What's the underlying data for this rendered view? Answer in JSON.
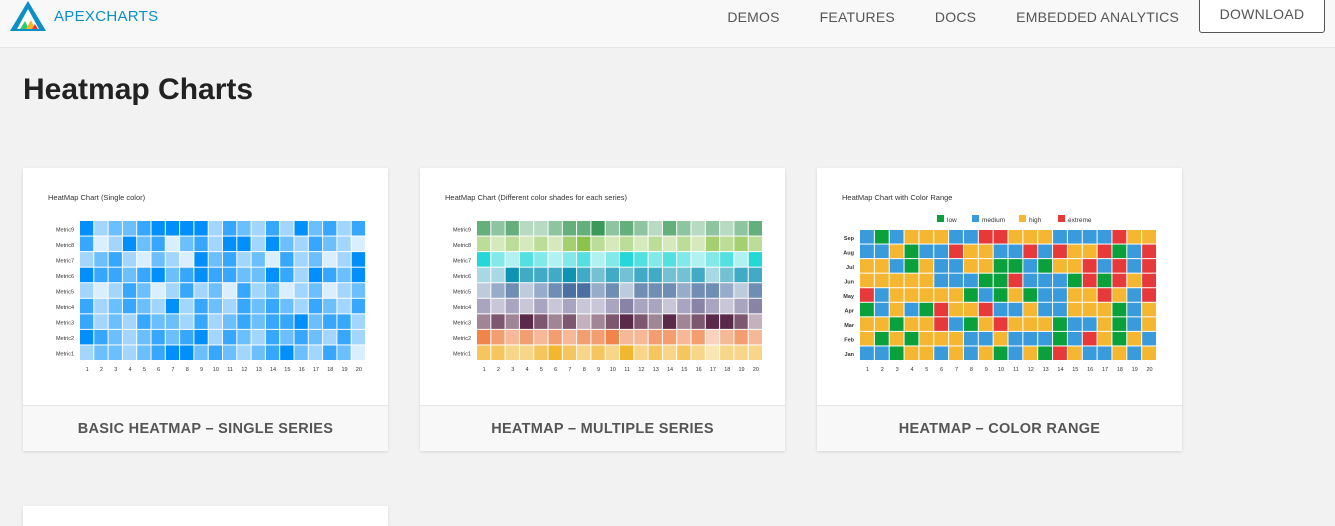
{
  "brand": {
    "name": "APEXCHARTS"
  },
  "nav": {
    "links": [
      "DEMOS",
      "FEATURES",
      "DOCS",
      "EMBEDDED ANALYTICS"
    ],
    "download_label": "DOWNLOAD"
  },
  "page": {
    "title": "Heatmap Charts"
  },
  "cards": [
    {
      "label": "BASIC HEATMAP – SINGLE SERIES"
    },
    {
      "label": "HEATMAP – MULTIPLE SERIES"
    },
    {
      "label": "HEATMAP – COLOR RANGE"
    }
  ],
  "chart_data": [
    {
      "type": "heatmap",
      "title": "HeatMap Chart (Single color)",
      "series_names": [
        "Metric9",
        "Metric8",
        "Metric7",
        "Metric6",
        "Metric5",
        "Metric4",
        "Metric3",
        "Metric2",
        "Metric1"
      ],
      "x": [
        "1",
        "2",
        "3",
        "4",
        "5",
        "6",
        "7",
        "8",
        "9",
        "10",
        "11",
        "12",
        "13",
        "14",
        "15",
        "16",
        "17",
        "18",
        "19",
        "20"
      ],
      "color": "#008FFB",
      "values": [
        [
          4,
          1,
          2,
          2,
          3,
          4,
          4,
          4,
          4,
          1,
          3,
          2,
          1,
          3,
          1,
          4,
          2,
          3,
          1,
          3
        ],
        [
          3,
          0,
          1,
          4,
          2,
          3,
          0,
          2,
          3,
          1,
          4,
          4,
          1,
          4,
          2,
          1,
          3,
          2,
          1,
          0
        ],
        [
          1,
          2,
          3,
          1,
          0,
          2,
          1,
          0,
          4,
          2,
          3,
          1,
          2,
          0,
          3,
          1,
          2,
          0,
          1,
          4
        ],
        [
          4,
          3,
          3,
          2,
          3,
          4,
          2,
          3,
          4,
          3,
          3,
          2,
          2,
          4,
          3,
          1,
          4,
          3,
          2,
          4
        ],
        [
          1,
          0,
          1,
          3,
          2,
          0,
          1,
          3,
          1,
          2,
          0,
          3,
          1,
          2,
          0,
          1,
          2,
          0,
          1,
          2
        ],
        [
          3,
          1,
          2,
          3,
          2,
          1,
          4,
          1,
          3,
          2,
          1,
          3,
          2,
          3,
          2,
          1,
          3,
          2,
          1,
          3
        ],
        [
          3,
          1,
          2,
          1,
          3,
          2,
          2,
          1,
          3,
          1,
          2,
          3,
          2,
          3,
          3,
          4,
          2,
          3,
          3,
          1
        ],
        [
          4,
          3,
          2,
          1,
          2,
          3,
          2,
          3,
          4,
          1,
          3,
          2,
          1,
          3,
          2,
          3,
          2,
          1,
          3,
          1
        ],
        [
          1,
          2,
          2,
          1,
          2,
          3,
          4,
          4,
          2,
          3,
          2,
          1,
          2,
          3,
          4,
          2,
          1,
          3,
          2,
          0
        ]
      ]
    },
    {
      "type": "heatmap",
      "title": "HeatMap Chart (Different color shades for each series)",
      "series_names": [
        "Metric9",
        "Metric8",
        "Metric7",
        "Metric6",
        "Metric5",
        "Metric4",
        "Metric3",
        "Metric2",
        "Metric1"
      ],
      "x": [
        "1",
        "2",
        "3",
        "4",
        "5",
        "6",
        "7",
        "8",
        "9",
        "10",
        "11",
        "12",
        "13",
        "14",
        "15",
        "16",
        "17",
        "18",
        "19",
        "20"
      ],
      "colors": [
        "#3B9A5A",
        "#8BC34A",
        "#26D7D7",
        "#0E93B5",
        "#4A6FA0",
        "#6A6190",
        "#5A2A4A",
        "#F0844A",
        "#F2B731"
      ],
      "values": [
        [
          3,
          2,
          3,
          1,
          1,
          2,
          3,
          3,
          4,
          2,
          3,
          2,
          1,
          3,
          2,
          1,
          2,
          1,
          2,
          3
        ],
        [
          2,
          1,
          2,
          1,
          2,
          1,
          3,
          4,
          2,
          1,
          2,
          1,
          2,
          1,
          2,
          1,
          3,
          2,
          3,
          2
        ],
        [
          4,
          2,
          1,
          3,
          2,
          1,
          2,
          3,
          1,
          2,
          4,
          3,
          2,
          3,
          2,
          1,
          2,
          3,
          1,
          4
        ],
        [
          1,
          1,
          4,
          3,
          3,
          3,
          4,
          3,
          2,
          3,
          2,
          3,
          3,
          2,
          2,
          3,
          1,
          2,
          3,
          3
        ],
        [
          1,
          2,
          3,
          1,
          2,
          3,
          4,
          4,
          2,
          3,
          1,
          3,
          3,
          3,
          2,
          3,
          3,
          2,
          1,
          3
        ],
        [
          2,
          1,
          2,
          1,
          2,
          1,
          2,
          1,
          1,
          2,
          3,
          2,
          2,
          1,
          2,
          3,
          2,
          1,
          2,
          3
        ],
        [
          2,
          3,
          2,
          4,
          3,
          2,
          3,
          1,
          2,
          3,
          4,
          3,
          2,
          4,
          2,
          3,
          4,
          4,
          3,
          1
        ],
        [
          4,
          3,
          2,
          3,
          2,
          3,
          2,
          3,
          3,
          4,
          2,
          2,
          3,
          3,
          2,
          3,
          1,
          2,
          3,
          2
        ],
        [
          3,
          3,
          2,
          2,
          3,
          4,
          3,
          2,
          3,
          2,
          4,
          2,
          3,
          2,
          3,
          2,
          1,
          2,
          2,
          2
        ]
      ]
    },
    {
      "type": "heatmap",
      "title": "HeatMap Chart with Color Range",
      "legend": [
        {
          "name": "low",
          "color": "#0AA03C"
        },
        {
          "name": "medium",
          "color": "#3A9BDC"
        },
        {
          "name": "high",
          "color": "#F5B731"
        },
        {
          "name": "extreme",
          "color": "#E8393A"
        }
      ],
      "legend_position": "top",
      "series_names": [
        "Sep",
        "Aug",
        "Jul",
        "Jun",
        "May",
        "Apr",
        "Mar",
        "Feb",
        "Jan"
      ],
      "x": [
        "1",
        "2",
        "3",
        "4",
        "5",
        "6",
        "7",
        "8",
        "9",
        "10",
        "11",
        "12",
        "13",
        "14",
        "15",
        "16",
        "17",
        "18",
        "19",
        "20"
      ],
      "values": [
        [
          1,
          0,
          1,
          2,
          2,
          2,
          1,
          1,
          3,
          3,
          2,
          2,
          2,
          1,
          1,
          1,
          1,
          3,
          2,
          2
        ],
        [
          1,
          1,
          2,
          0,
          1,
          1,
          3,
          2,
          2,
          1,
          1,
          3,
          1,
          3,
          2,
          2,
          3,
          0,
          1,
          3
        ],
        [
          2,
          2,
          1,
          0,
          2,
          1,
          1,
          2,
          2,
          0,
          0,
          1,
          0,
          2,
          2,
          3,
          1,
          3,
          1,
          3
        ],
        [
          2,
          2,
          2,
          2,
          2,
          1,
          1,
          1,
          0,
          0,
          3,
          1,
          1,
          1,
          0,
          3,
          0,
          3,
          2,
          3
        ],
        [
          3,
          1,
          2,
          2,
          2,
          2,
          2,
          0,
          1,
          0,
          2,
          0,
          1,
          1,
          2,
          2,
          3,
          2,
          1,
          3
        ],
        [
          0,
          1,
          2,
          1,
          0,
          3,
          2,
          2,
          3,
          1,
          1,
          2,
          1,
          1,
          2,
          2,
          2,
          0,
          1,
          2
        ],
        [
          2,
          2,
          0,
          2,
          2,
          3,
          1,
          0,
          2,
          3,
          2,
          2,
          2,
          0,
          1,
          1,
          2,
          0,
          1,
          2
        ],
        [
          2,
          0,
          2,
          0,
          2,
          2,
          2,
          1,
          1,
          2,
          1,
          1,
          1,
          0,
          1,
          3,
          2,
          0,
          2,
          1
        ],
        [
          1,
          1,
          0,
          2,
          2,
          1,
          2,
          1,
          2,
          0,
          1,
          2,
          0,
          3,
          2,
          1,
          1,
          2,
          1,
          2
        ]
      ]
    }
  ]
}
